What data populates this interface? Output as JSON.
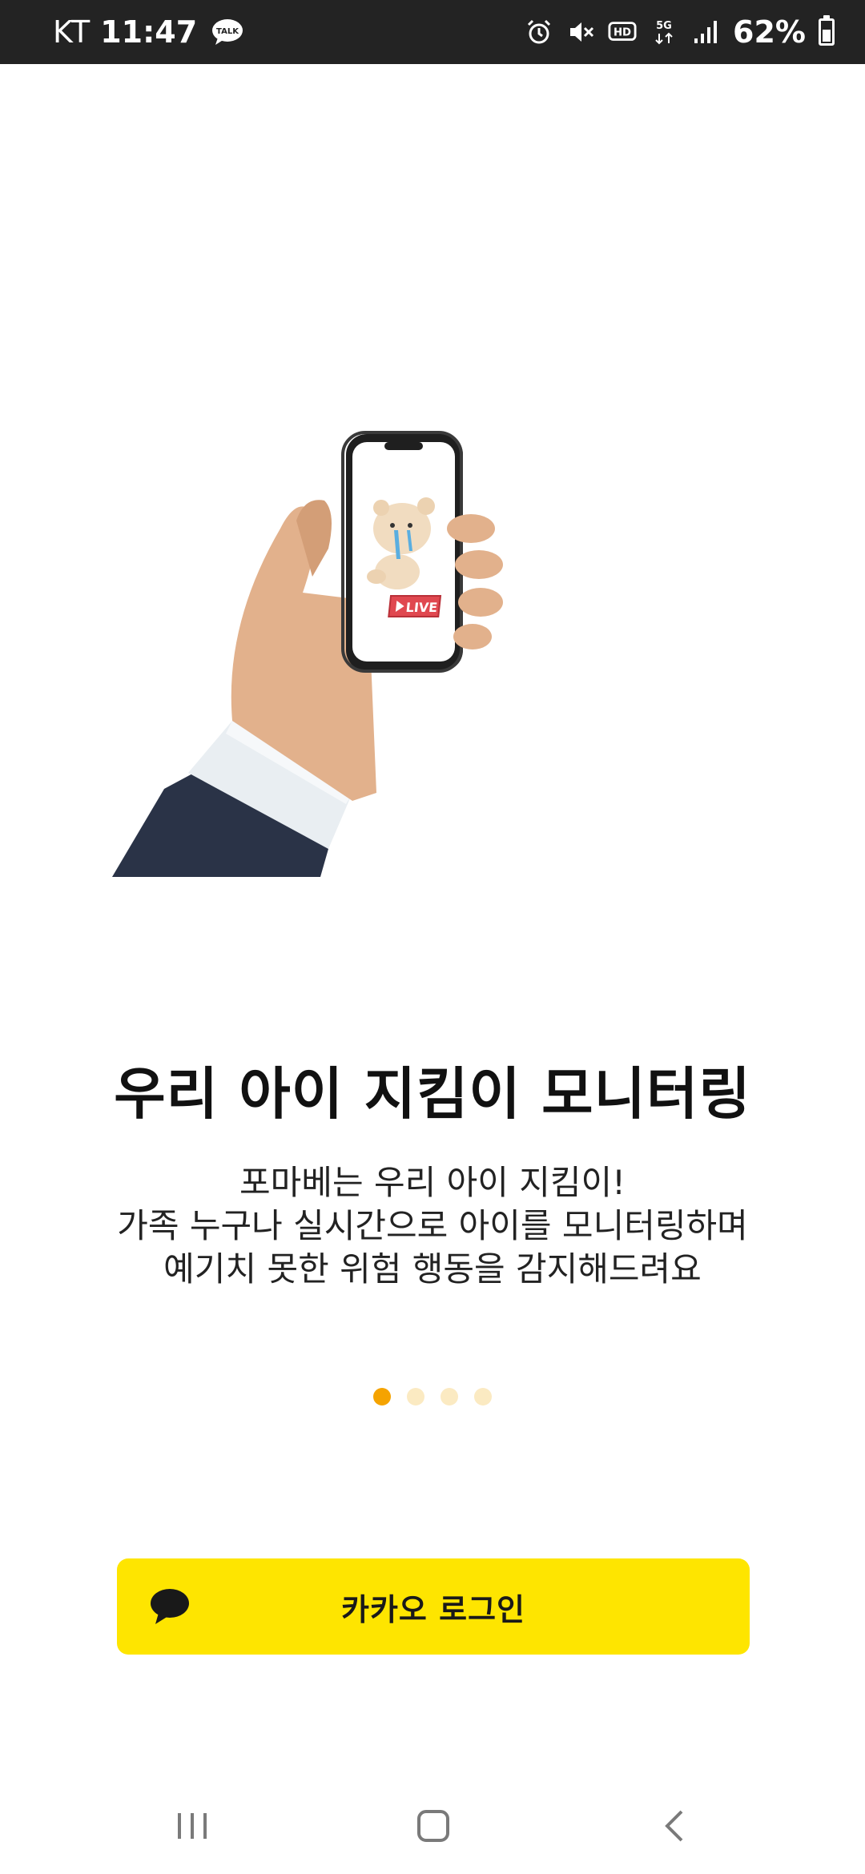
{
  "status_bar": {
    "carrier": "KT",
    "time": "11:47",
    "battery": "62%",
    "icons": [
      "talk-icon",
      "alarm-icon",
      "mute-icon",
      "hd-icon",
      "5g-icon",
      "signal-icon",
      "battery-icon"
    ]
  },
  "onboarding": {
    "title": "우리 아이 지킴이 모니터링",
    "description_lines": [
      "포마베는 우리 아이 지킴이!",
      "가족 누구나 실시간으로 아이를 모니터링하며",
      "예기치 못한 위험 행동을 감지해드려요"
    ],
    "illustration_badge": "LIVE",
    "pagination": {
      "total": 4,
      "active_index": 0
    }
  },
  "login": {
    "label": "카카오 로그인",
    "icon": "kakao-bubble-icon",
    "color": "#FEE500"
  },
  "nav": {
    "icons": [
      "recent-apps-icon",
      "home-icon",
      "back-icon"
    ]
  },
  "colors": {
    "accent_dot": "#F5A300",
    "inactive_dot": "#FBEAC2",
    "status_bar_bg": "#232323"
  }
}
